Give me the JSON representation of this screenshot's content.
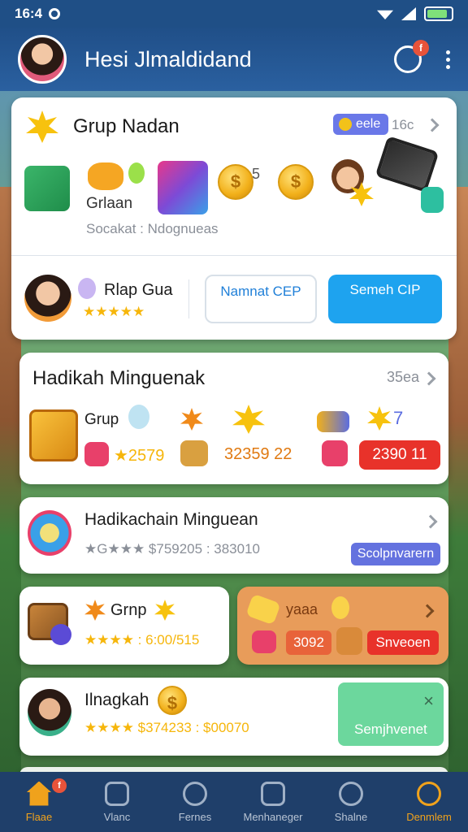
{
  "status_bar": {
    "time": "16:4"
  },
  "header": {
    "title": "Hesi Jlmaldidand",
    "chat_badge": "f"
  },
  "card1": {
    "title": "Grup Nadan",
    "pill": "eele",
    "count": "16c",
    "item_label": "Grlaan",
    "sub_text": "Socakat : Ndognueas",
    "reward_number": "5",
    "player_name": "Rlap Gua",
    "stars": "★★★★★",
    "btn_outline": "Namnat CEP",
    "btn_blue": "Semeh CIP"
  },
  "card2": {
    "title": "Hadikah Minguenak",
    "count": "35ea",
    "grup": "Grup",
    "stat_a": "★2579",
    "stat_b": "32359 22",
    "side_num": "7",
    "btn_red": "2390 11"
  },
  "card3": {
    "title": "Hadikachain Minguean",
    "stats": "★G★★★  $759205 : 383010",
    "btn": "Scolpnvarern"
  },
  "card4": {
    "title": "Grnp",
    "stats": "★★★★ : 6:00/515"
  },
  "card5": {
    "title": "yaaa",
    "pct": "3092",
    "btn": "Snveoen"
  },
  "card6": {
    "title": "Ilnagkah",
    "stats": "★★★★  $374233 : $00070",
    "btn": "Semjhvenet",
    "close": "×"
  },
  "nav": [
    {
      "label": "Flaae",
      "badge": "f"
    },
    {
      "label": "Vlanc"
    },
    {
      "label": "Fernes"
    },
    {
      "label": "Menhaneger"
    },
    {
      "label": "Shalne"
    },
    {
      "label": "Denmlem"
    }
  ],
  "colors": {
    "accent_blue": "#1ea3ef",
    "header_blue": "#204f88",
    "nav_bg": "#1f3f6a",
    "red": "#e8322a",
    "orange_card": "#e89c5a"
  }
}
